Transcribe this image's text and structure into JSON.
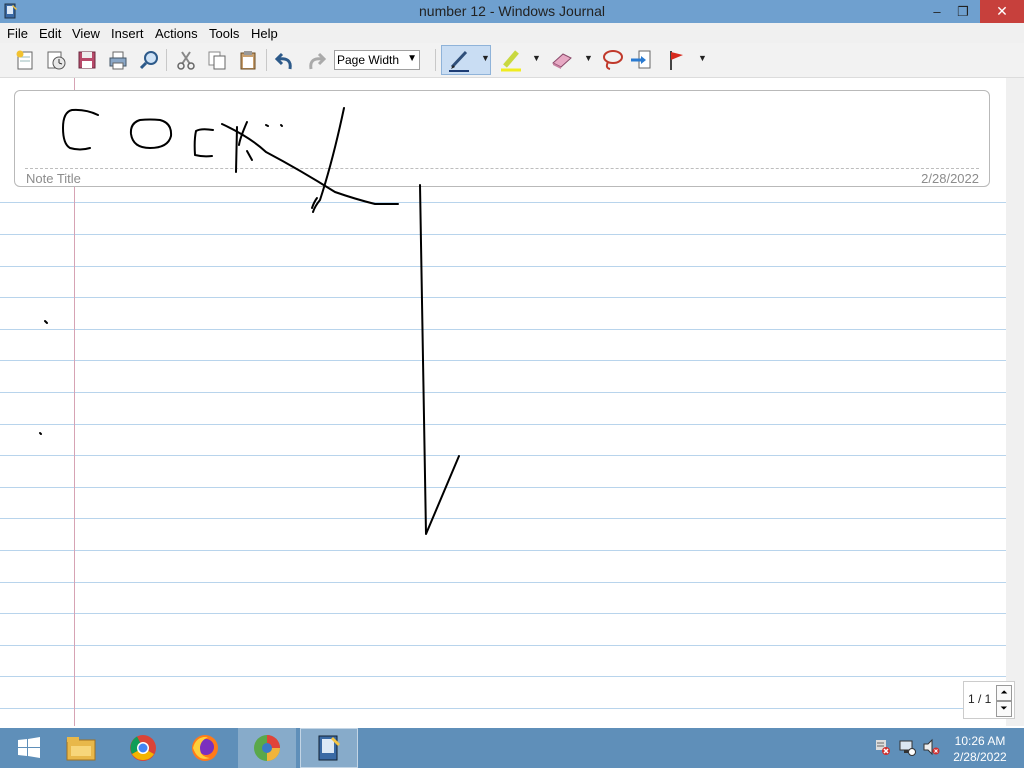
{
  "window": {
    "title": "number 12 - Windows Journal",
    "min_glyph": "–",
    "max_glyph": "❐",
    "close_glyph": "✕"
  },
  "menu": [
    "File",
    "Edit",
    "View",
    "Insert",
    "Actions",
    "Tools",
    "Help"
  ],
  "toolbar": {
    "zoom_value": "Page Width",
    "icons": [
      "new-note-icon",
      "open-icon",
      "save-icon",
      "print-icon",
      "find-icon",
      "cut-icon",
      "copy-icon",
      "paste-icon",
      "undo-icon",
      "redo-icon",
      "pen-icon",
      "highlighter-icon",
      "eraser-icon",
      "lasso-icon",
      "insert-space-icon",
      "flag-icon"
    ]
  },
  "note": {
    "title_placeholder": "Note Title",
    "date": "2/28/2022"
  },
  "pager": {
    "label": "1 / 1"
  },
  "taskbar": {
    "apps": [
      "start-icon",
      "file-explorer-icon",
      "chrome-icon",
      "firefox-icon",
      "app-icon",
      "windows-journal-icon"
    ],
    "clock_time": "10:26 AM",
    "clock_date": "2/28/2022"
  },
  "colors": {
    "titlebar": "#6fa0cf",
    "taskbar": "#5f8fb9",
    "rule": "#b8d4ec",
    "margin": "#d6a3b4",
    "close": "#c7403c"
  }
}
